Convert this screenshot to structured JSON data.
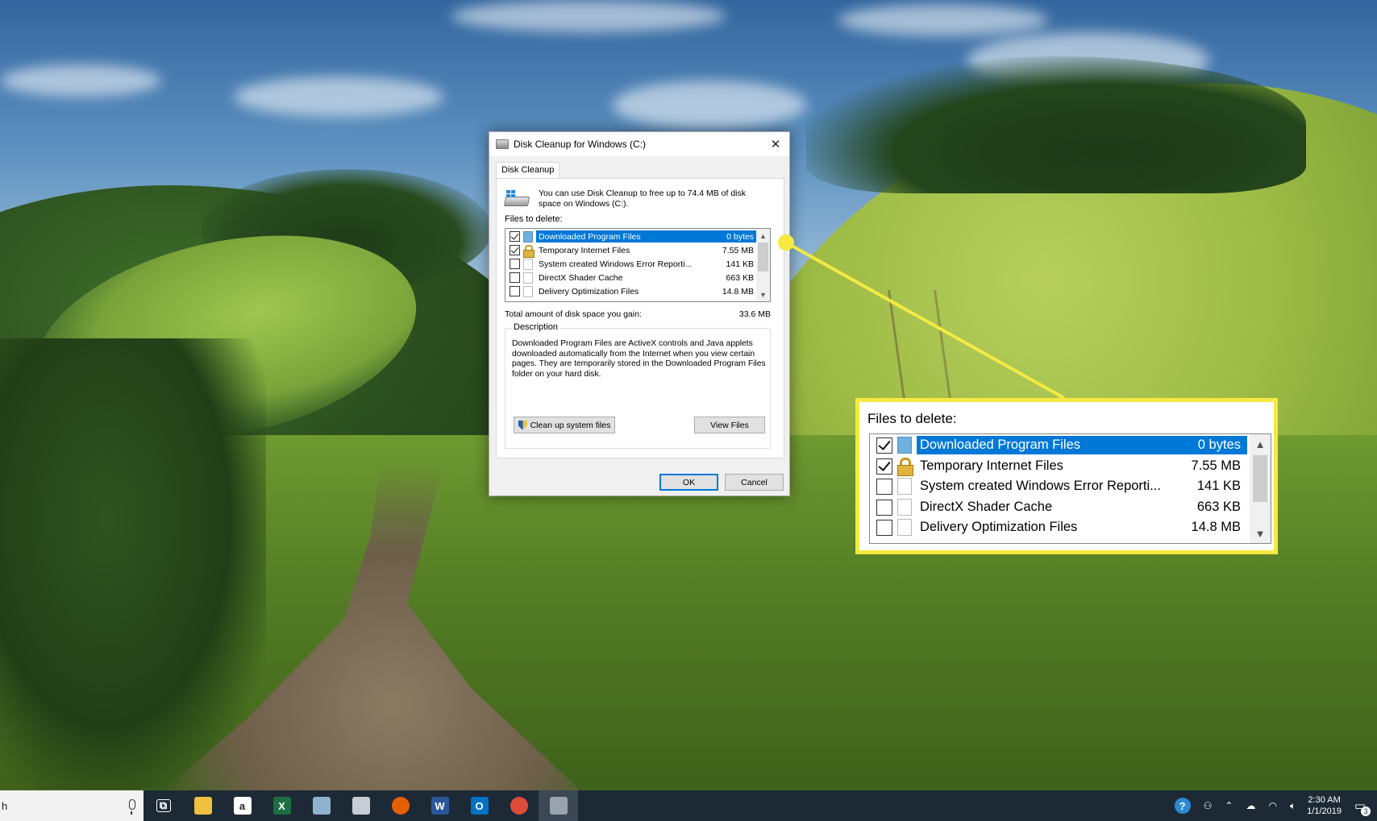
{
  "dialog": {
    "title": "Disk Cleanup for Windows (C:)",
    "close_glyph": "✕",
    "tab_label": "Disk Cleanup",
    "intro_text": "You can use Disk Cleanup to free up to 74.4 MB of disk space on Windows (C:).",
    "files_label": "Files to delete:",
    "files": [
      {
        "name": "Downloaded Program Files",
        "size": "0 bytes",
        "checked": true,
        "selected": true,
        "icon": "folder-blue-icon"
      },
      {
        "name": "Temporary Internet Files",
        "size": "7.55 MB",
        "checked": true,
        "selected": false,
        "icon": "lock-icon"
      },
      {
        "name": "System created Windows Error Reporti...",
        "size": "141 KB",
        "checked": false,
        "selected": false,
        "icon": "blank-file-icon"
      },
      {
        "name": "DirectX Shader Cache",
        "size": "663 KB",
        "checked": false,
        "selected": false,
        "icon": "blank-file-icon"
      },
      {
        "name": "Delivery Optimization Files",
        "size": "14.8 MB",
        "checked": false,
        "selected": false,
        "icon": "blank-file-icon"
      }
    ],
    "total_label": "Total amount of disk space you gain:",
    "total_value": "33.6 MB",
    "description_legend": "Description",
    "description_text": "Downloaded Program Files are ActiveX controls and Java applets downloaded automatically from the Internet when you view certain pages. They are temporarily stored in the Downloaded Program Files folder on your hard disk.",
    "cleanup_system_label": "Clean up system files",
    "view_files_label": "View Files",
    "ok_label": "OK",
    "cancel_label": "Cancel"
  },
  "callout": {
    "label": "Files to delete:",
    "accent": "#f5e942"
  },
  "taskbar": {
    "search_text": "h",
    "apps": [
      {
        "name": "task-view-icon",
        "glyph": "⧉",
        "color": "#1d2a36"
      },
      {
        "name": "file-explorer-icon",
        "glyph": "",
        "color": "#f0c040"
      },
      {
        "name": "amazon-icon",
        "glyph": "a",
        "color": "#ffffff"
      },
      {
        "name": "excel-icon",
        "glyph": "X",
        "color": "#1d6f42"
      },
      {
        "name": "notes-app-icon",
        "glyph": "",
        "color": "#8fb3cf"
      },
      {
        "name": "cloud-app-icon",
        "glyph": "",
        "color": "#c7cdd3"
      },
      {
        "name": "firefox-icon",
        "glyph": "",
        "color": "#e66000"
      },
      {
        "name": "word-icon",
        "glyph": "W",
        "color": "#2b579a"
      },
      {
        "name": "outlook-icon",
        "glyph": "O",
        "color": "#0072c6"
      },
      {
        "name": "chrome-icon",
        "glyph": "",
        "color": "#dd4b39"
      },
      {
        "name": "disk-cleanup-icon",
        "glyph": "",
        "color": "#9aa3ab"
      }
    ],
    "time": "2:30 AM",
    "date": "1/1/2019",
    "notification_count": "3"
  },
  "colors": {
    "selection": "#0078d7",
    "taskbar": "#1d2a36",
    "dialog_bg": "#f0f0f0"
  }
}
